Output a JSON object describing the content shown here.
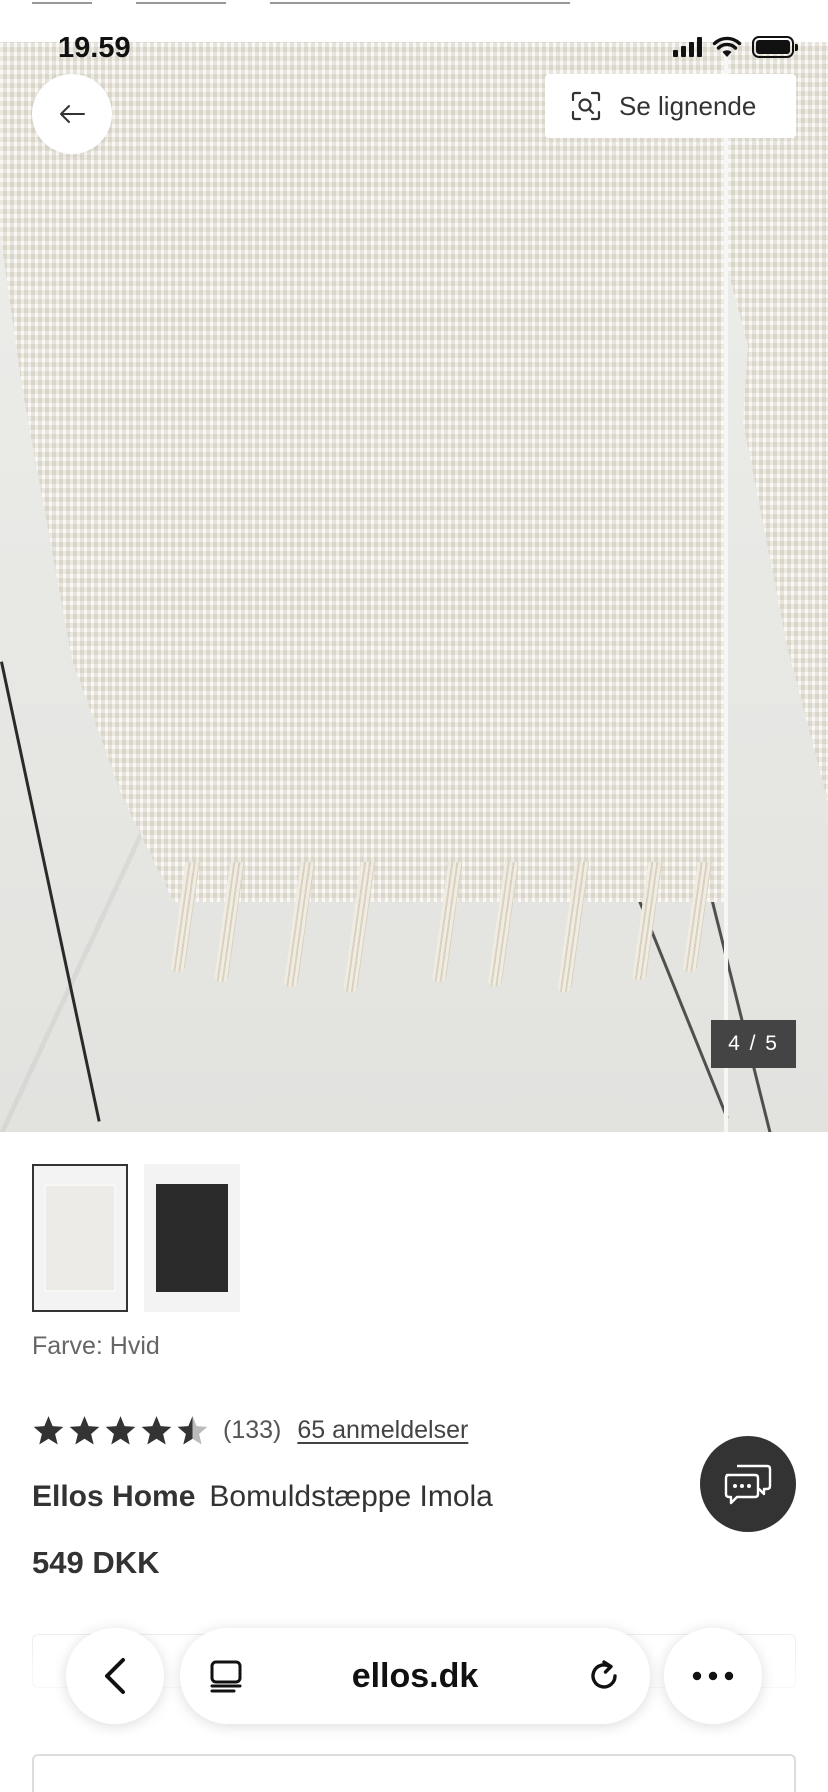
{
  "status_bar": {
    "time": "19.59"
  },
  "hero": {
    "similar_label": "Se lignende",
    "image_counter": "4 / 5"
  },
  "thumbnails": [
    {
      "color": "white",
      "selected": true
    },
    {
      "color": "black",
      "selected": false
    }
  ],
  "color": {
    "text": "Farve: Hvid"
  },
  "rating": {
    "value": 4.5,
    "count": "(133)",
    "reviews_link": "65 anmeldelser"
  },
  "product": {
    "brand": "Ellos Home",
    "name": "Bomuldstæppe Imola",
    "price": "549 DKK"
  },
  "browser": {
    "url": "ellos.dk"
  },
  "colors": {
    "text": "#333333",
    "counter_bg": "#444444",
    "chat_bg": "#333333"
  }
}
